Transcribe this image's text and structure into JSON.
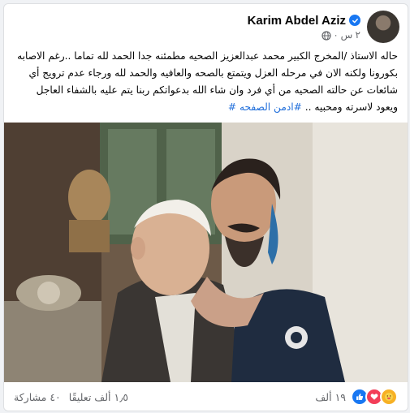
{
  "post": {
    "author": "Karim Abdel Aziz",
    "time": "٢ س",
    "text_main": "حاله الاستاذ /المخرج الكبير محمد عبدالعزيز الصحيه مطمئنه جدا الحمد لله تماما ..رغم الاصابه بكورونا ولكنه الان في مرحله العزل ويتمتع بالصحه والعافيه والحمد لله ورجاء عدم ترويج أي شائعات عن حالته الصحيه من أي فرد وان شاء الله بدعواتكم ربنا يتم عليه بالشفاء العاجل ويعود لاسرته ومحبيه ..",
    "hashtag": "#ادمن الصفحه #"
  },
  "stats": {
    "reactions": "١٩ ألف",
    "comments": "١٫٥ ألف تعليقًا",
    "shares": "٤٠ مشاركة"
  },
  "icons": {
    "verified": "verified-badge-icon",
    "audience": "globe-icon",
    "like": "like-icon",
    "love": "love-icon",
    "care": "care-icon"
  },
  "colors": {
    "link": "#216fdb",
    "facebook_blue": "#1877f2",
    "love_red": "#f33e58",
    "care_yellow": "#f7b125"
  }
}
